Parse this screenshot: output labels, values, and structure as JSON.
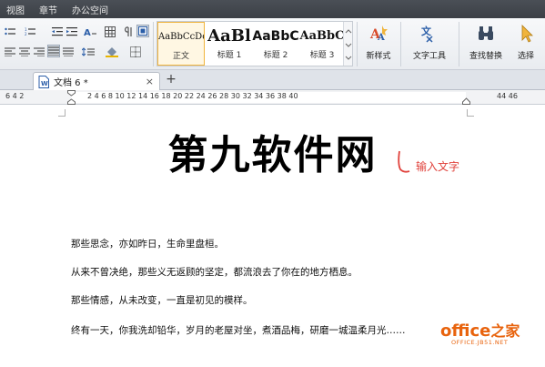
{
  "menu": {
    "items": [
      "视图",
      "章节",
      "办公空间"
    ]
  },
  "ribbon": {
    "styles": [
      {
        "sample": "AaBbCcDd",
        "name": "正文"
      },
      {
        "sample": "AaBl",
        "name": "标题 1"
      },
      {
        "sample": "AaBbC",
        "name": "标题 2"
      },
      {
        "sample": "AaBbC",
        "name": "标题 3"
      }
    ],
    "new_style_label": "新样式",
    "text_tools_label": "文字工具",
    "find_replace_label": "查找替换",
    "select_label": "选择"
  },
  "tabs": {
    "doc_tab_label": "文档 6 *",
    "close_glyph": "×",
    "add_glyph": "+"
  },
  "ruler": {
    "left_text": "6   4   2",
    "marks": "2   4   6   8   10  12  14  16  18  20  22  24  26  28  30  32  34  36  38  40",
    "right_text": "44  46"
  },
  "document": {
    "heading": "第九软件网",
    "annotation": "输入文字",
    "paragraphs": [
      "那些思念，亦如昨日，生命里盘桓。",
      "从来不曾决绝，那些义无返顾的坚定，都流浪去了你在的地方栖息。",
      "那些情感，从未改变，一直是初见的模样。",
      "终有一天，你我洗却铅华，岁月的老屋对坐，煮酒品梅，研磨一城温柔月光……"
    ]
  },
  "watermark": {
    "brand": "office",
    "brand_zh": "之家",
    "url": "OFFICE.JB51.NET"
  },
  "colors": {
    "menubar": "#3f434a",
    "annotation": "#e0403a",
    "watermark": "#e8630d"
  }
}
